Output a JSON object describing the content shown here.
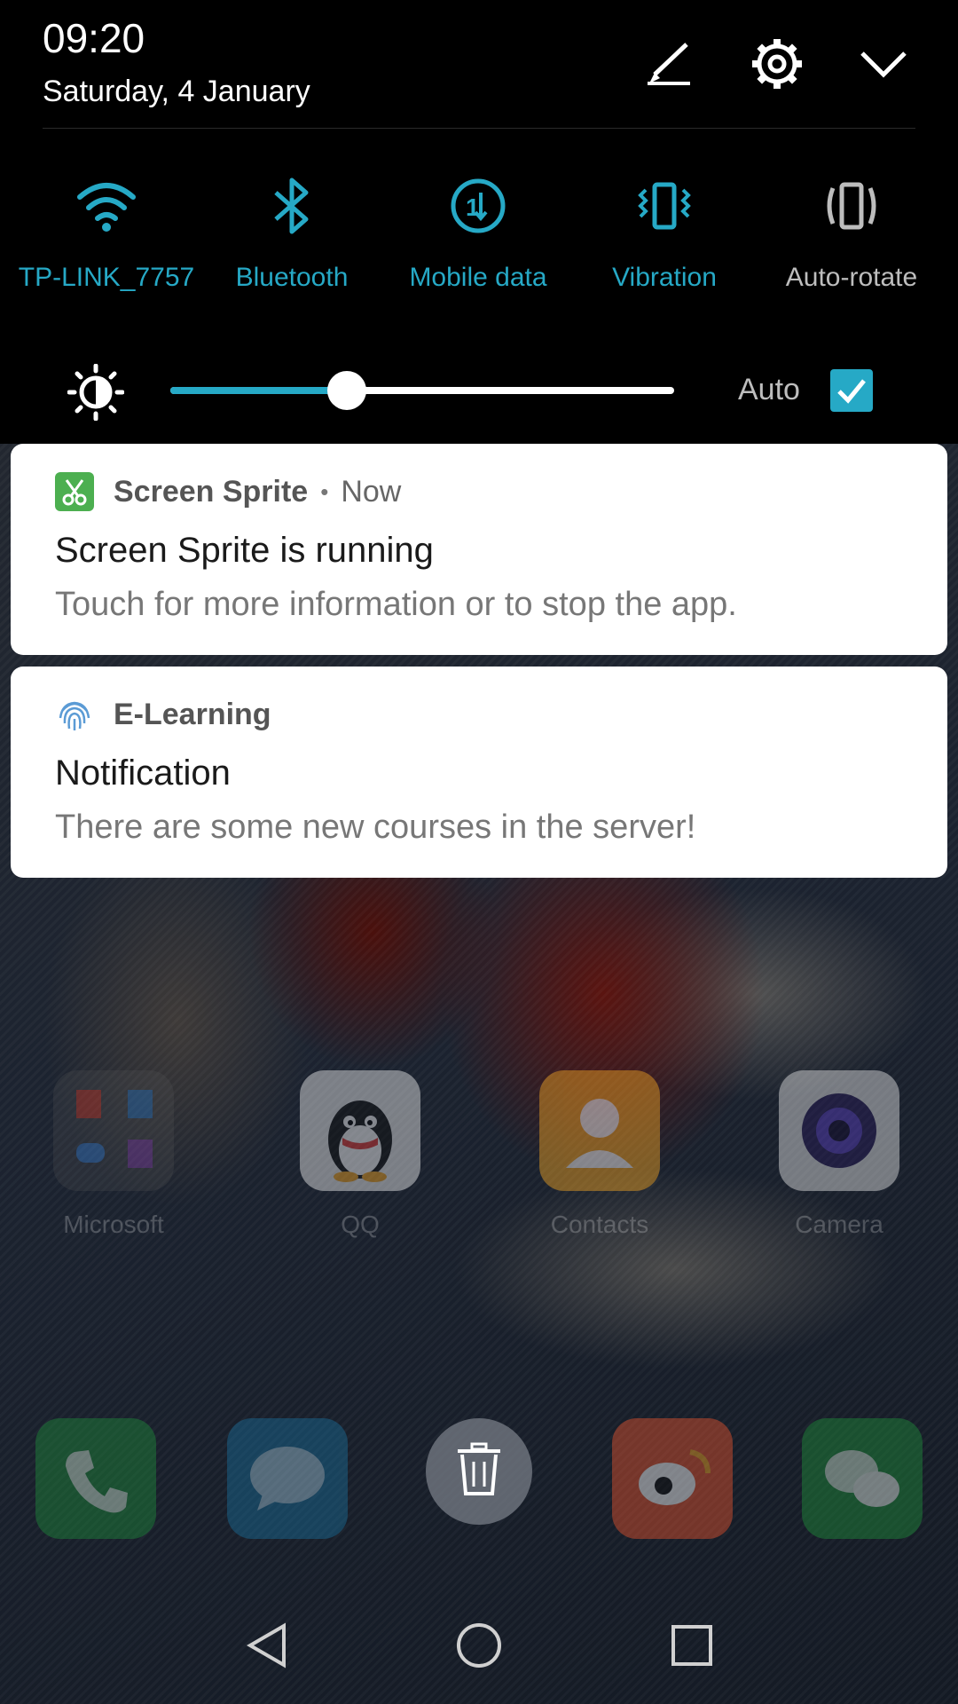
{
  "status": {
    "time": "09:20",
    "date": "Saturday, 4 January"
  },
  "header_icons": [
    "edit-icon",
    "settings-icon",
    "collapse-chevron-icon"
  ],
  "quick_settings": {
    "accent_color": "#26a9c6",
    "tiles": [
      {
        "label": "TP-LINK_7757",
        "icon": "wifi-icon",
        "active": true
      },
      {
        "label": "Bluetooth",
        "icon": "bluetooth-icon",
        "active": true
      },
      {
        "label": "Mobile data",
        "icon": "mobile-data-icon",
        "active": true
      },
      {
        "label": "Vibration",
        "icon": "vibration-icon",
        "active": true
      },
      {
        "label": "Auto-rotate",
        "icon": "auto-rotate-icon",
        "active": false
      }
    ]
  },
  "brightness": {
    "level": 0.35,
    "auto_label": "Auto",
    "auto_checked": true
  },
  "notifications": [
    {
      "app": "Screen Sprite",
      "separator": "•",
      "time": "Now",
      "title": "Screen Sprite is running",
      "body": "Touch for more information or to stop the app.",
      "icon": "screen-sprite-icon",
      "icon_color": "#4caf50"
    },
    {
      "app": "E-Learning",
      "title": "Notification",
      "body": "There are some new courses in the server!",
      "icon": "fingerprint-icon"
    }
  ],
  "home_screen": {
    "apps": [
      {
        "label": "Microsoft",
        "icon": "microsoft-folder-icon"
      },
      {
        "label": "QQ",
        "icon": "qq-icon"
      },
      {
        "label": "Contacts",
        "icon": "contacts-icon"
      },
      {
        "label": "Camera",
        "icon": "camera-icon"
      }
    ],
    "dock": [
      "phone-icon",
      "messages-icon",
      "weibo-icon",
      "wechat-icon"
    ]
  },
  "clear_button_icon": "trash-icon",
  "navigation": [
    "back-icon",
    "home-icon",
    "recents-icon"
  ]
}
